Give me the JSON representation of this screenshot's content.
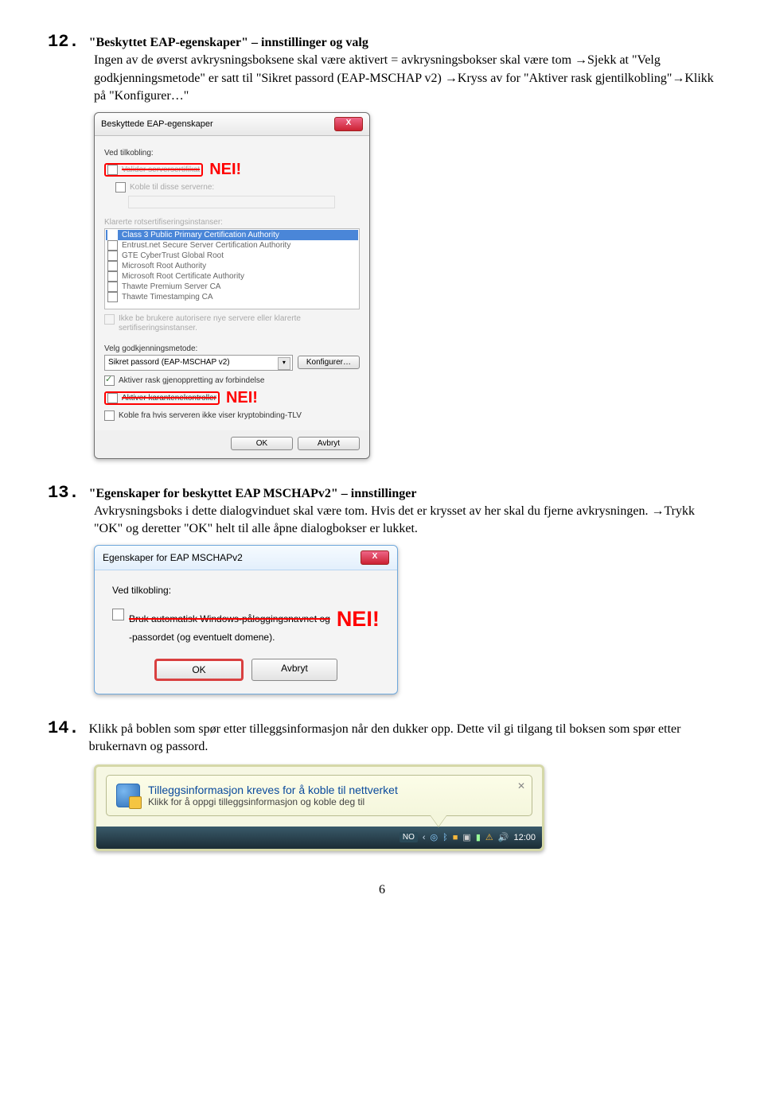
{
  "step12": {
    "number": "12.",
    "title": "\"Beskyttet EAP-egenskaper\" – innstillinger og valg",
    "body": "Ingen av de øverst avkrysningsboksene skal være aktivert = avkrysningsbokser skal være tom →Sjekk at \"Velg godkjenningsmetode\" er satt til \"Sikret passord (EAP-MSCHAP v2) →Kryss av for \"Aktiver rask gjentilkobling\"→Klikk på \"Konfigurer…\""
  },
  "dialog1": {
    "title": "Beskyttede EAP-egenskaper",
    "ved_tilkobling": "Ved tilkobling:",
    "valider": "Valider serversertifikat",
    "koble_til": "Koble til disse serverne:",
    "klarerte": "Klarerte rotsertifiseringsinstanser:",
    "list": [
      "Class 3 Public Primary Certification Authority",
      "Entrust.net Secure Server Certification Authority",
      "GTE CyberTrust Global Root",
      "Microsoft Root Authority",
      "Microsoft Root Certificate Authority",
      "Thawte Premium Server CA",
      "Thawte Timestamping CA"
    ],
    "ikke_be": "Ikke be brukere autorisere nye servere eller klarerte sertifiseringsinstanser.",
    "velg_godkj": "Velg godkjenningsmetode:",
    "method": "Sikret passord (EAP-MSCHAP v2)",
    "konfigurer": "Konfigurer…",
    "aktiver_rask": "Aktiver rask gjenoppretting av forbindelse",
    "aktiver_kar": "Aktiver karantenekontroller",
    "koble_fra": "Koble fra hvis serveren ikke viser kryptobinding-TLV",
    "ok": "OK",
    "avbryt": "Avbryt",
    "nei1": "NEI!",
    "nei2": "NEI!"
  },
  "step13": {
    "number": "13.",
    "title": "\"Egenskaper for beskyttet EAP MSCHAPv2\" – innstillinger",
    "body": "Avkrysningsboks i dette dialogvinduet skal være tom.  Hvis det er krysset av her skal du fjerne avkrysningen. →Trykk \"OK\" og deretter \"OK\" helt til alle åpne dialogbokser er lukket."
  },
  "dialog2": {
    "title": "Egenskaper for EAP MSCHAPv2",
    "ved": "Ved tilkobling:",
    "auto": "Bruk automatisk Windows-påloggingsnavnet og -passordet (og eventuelt domene).",
    "nei": "NEI!",
    "ok": "OK",
    "avbryt": "Avbryt"
  },
  "step14": {
    "number": "14.",
    "body": "Klikk på boblen som spør etter tilleggsinformasjon når den dukker opp. Dette vil gi tilgang til boksen som spør etter brukernavn og passord."
  },
  "balloon": {
    "title": "Tilleggsinformasjon kreves for å koble til nettverket",
    "sub": "Klikk for å oppgi tilleggsinformasjon og koble deg til"
  },
  "taskbar": {
    "lang": "NO",
    "time": "12:00"
  },
  "page": "6"
}
